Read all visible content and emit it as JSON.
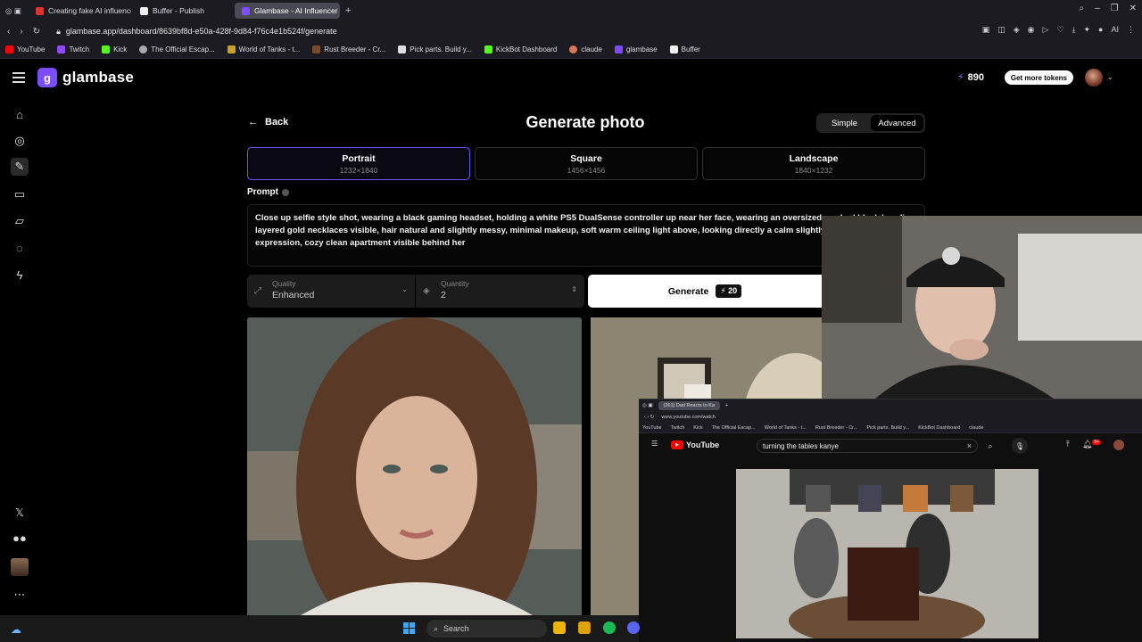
{
  "browser": {
    "tabs": [
      {
        "label": "Creating fake AI influence",
        "active": false
      },
      {
        "label": "Buffer - Publish",
        "active": false
      },
      {
        "label": "Glambase - AI Influencer C",
        "active": true
      }
    ],
    "url": "glambase.app/dashboard/8639bf8d-e50a-428f-9d84-f76c4e1b524f/generate",
    "bookmarks": [
      "YouTube",
      "Twitch",
      "Kick",
      "The Official Escap...",
      "World of Tanks - t...",
      "Rust Breeder - Cr...",
      "Pick parts. Build y...",
      "KickBot Dashboard",
      "claude",
      "glambase",
      "Buffer"
    ]
  },
  "app": {
    "brand": "glambase",
    "token_count": "890",
    "get_tokens_label": "Get more tokens"
  },
  "generate": {
    "back_label": "Back",
    "title": "Generate photo",
    "mode_simple": "Simple",
    "mode_advanced": "Advanced",
    "ratios": [
      {
        "label": "Portrait",
        "dims": "1232×1840",
        "selected": true
      },
      {
        "label": "Square",
        "dims": "1456×1456",
        "selected": false
      },
      {
        "label": "Landscape",
        "dims": "1840×1232",
        "selected": false
      }
    ],
    "prompt_label": "Prompt",
    "prompt_text": "Close up selfie style shot, wearing a black gaming headset, holding a white PS5 DualSense controller up near her face, wearing an oversized washed black hoodie, layered gold necklaces visible, hair natural and slightly messy, minimal makeup, soft warm ceiling light above, looking directly a calm slightly competitive expression, cozy clean apartment visible behind her",
    "quality_label": "Quality",
    "quality_value": "Enhanced",
    "quantity_label": "Quantity",
    "quantity_value": "2",
    "generate_label": "Generate",
    "generate_cost": "20"
  },
  "youtube_window": {
    "tab_label": "(261) Dad Reacts to Ka",
    "url": "www.youtube.com/watch",
    "bookmarks": [
      "YouTube",
      "Twitch",
      "Kick",
      "The Official Escap...",
      "World of Tanks - t...",
      "Rust Breeder - Cr...",
      "Pick parts. Build y...",
      "KickBot Dashboard",
      "claude"
    ],
    "logo": "YouTube",
    "search_query": "turning the tables kanye",
    "notif_count": "9+"
  },
  "taskbar": {
    "search_placeholder": "Search"
  },
  "colors": {
    "accent": "#7c4dff",
    "background": "#000000"
  }
}
